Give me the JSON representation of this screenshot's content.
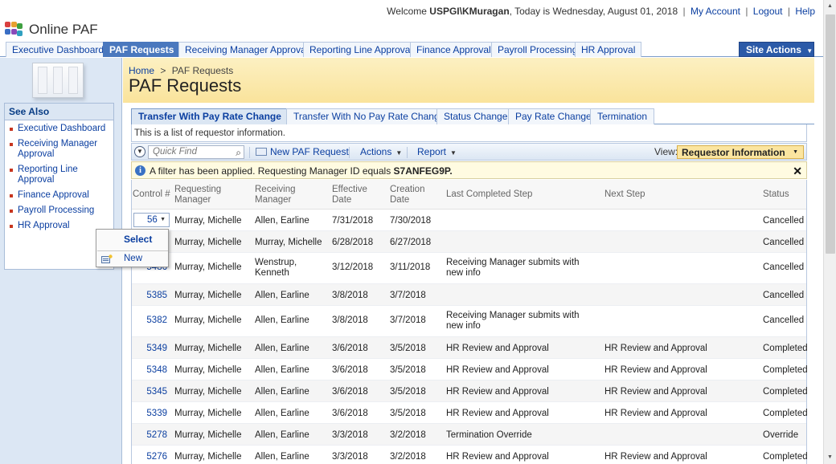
{
  "welcome": {
    "prefix": "Welcome",
    "user": "USPGI\\KMuragan",
    "today": ", Today is Wednesday, August 01, 2018",
    "links": [
      "My Account",
      "Logout",
      "Help"
    ]
  },
  "brand": {
    "title": "Online PAF"
  },
  "nav_tabs": [
    "Executive Dashboard",
    "PAF Requests",
    "Receiving Manager Approval",
    "Reporting Line Approval",
    "Finance Approval",
    "Payroll Processing",
    "HR Approval"
  ],
  "nav_active": "PAF Requests",
  "site_actions": {
    "label": "Site Actions",
    "arrow": "▼"
  },
  "see_also": {
    "title": "See Also",
    "items": [
      "Executive Dashboard",
      "Receiving Manager Approval",
      "Reporting Line Approval",
      "Finance Approval",
      "Payroll Processing",
      "HR Approval"
    ]
  },
  "breadcrumb": {
    "home": "Home",
    "separator": ">",
    "current": "PAF Requests"
  },
  "page_title": "PAF Requests",
  "view_tabs": [
    "Transfer With Pay Rate Change",
    "Transfer With No Pay Rate Change",
    "Status Change",
    "Pay Rate Change",
    "Termination"
  ],
  "list_description": "This is a list of requestor information.",
  "toolbar": {
    "quick_find_placeholder": "Quick Find",
    "new_request": "New PAF Request",
    "actions": "Actions",
    "report": "Report",
    "view_label": "View:",
    "view_value": "Requestor Information"
  },
  "filter": {
    "text": "A filter has been applied. Requesting Manager ID equals ",
    "value": "S7ANFEG9P."
  },
  "columns": [
    "Control #",
    "Requesting Manager",
    "Receiving Manager",
    "Effective Date",
    "Creation Date",
    "Last Completed Step",
    "Next Step",
    "Status"
  ],
  "rows": [
    {
      "control": "56",
      "req": "Murray, Michelle",
      "recv": "Allen, Earline",
      "eff": "7/31/2018",
      "created": "7/30/2018",
      "last": "",
      "next": "",
      "status": "Cancelled"
    },
    {
      "control": "",
      "req": "Murray, Michelle",
      "recv": "Murray, Michelle",
      "eff": "6/28/2018",
      "created": "6/27/2018",
      "last": "",
      "next": "",
      "status": "Cancelled"
    },
    {
      "control": "5486",
      "req": "Murray, Michelle",
      "recv": "Wenstrup, Kenneth",
      "eff": "3/12/2018",
      "created": "3/11/2018",
      "last": "Receiving Manager submits with new info",
      "next": "",
      "status": "Cancelled"
    },
    {
      "control": "5385",
      "req": "Murray, Michelle",
      "recv": "Allen, Earline",
      "eff": "3/8/2018",
      "created": "3/7/2018",
      "last": "",
      "next": "",
      "status": "Cancelled"
    },
    {
      "control": "5382",
      "req": "Murray, Michelle",
      "recv": "Allen, Earline",
      "eff": "3/8/2018",
      "created": "3/7/2018",
      "last": "Receiving Manager submits with new info",
      "next": "",
      "status": "Cancelled"
    },
    {
      "control": "5349",
      "req": "Murray, Michelle",
      "recv": "Allen, Earline",
      "eff": "3/6/2018",
      "created": "3/5/2018",
      "last": "HR Review and Approval",
      "next": "HR Review and Approval",
      "status": "Completed"
    },
    {
      "control": "5348",
      "req": "Murray, Michelle",
      "recv": "Allen, Earline",
      "eff": "3/6/2018",
      "created": "3/5/2018",
      "last": "HR Review and Approval",
      "next": "HR Review and Approval",
      "status": "Completed"
    },
    {
      "control": "5345",
      "req": "Murray, Michelle",
      "recv": "Allen, Earline",
      "eff": "3/6/2018",
      "created": "3/5/2018",
      "last": "HR Review and Approval",
      "next": "HR Review and Approval",
      "status": "Completed"
    },
    {
      "control": "5339",
      "req": "Murray, Michelle",
      "recv": "Allen, Earline",
      "eff": "3/6/2018",
      "created": "3/5/2018",
      "last": "HR Review and Approval",
      "next": "HR Review and Approval",
      "status": "Completed"
    },
    {
      "control": "5278",
      "req": "Murray, Michelle",
      "recv": "Allen, Earline",
      "eff": "3/3/2018",
      "created": "3/2/2018",
      "last": "Termination Override",
      "next": "",
      "status": "Override"
    },
    {
      "control": "5276",
      "req": "Murray, Michelle",
      "recv": "Allen, Earline",
      "eff": "3/3/2018",
      "created": "3/2/2018",
      "last": "HR Review and Approval",
      "next": "HR Review and Approval",
      "status": "Completed"
    }
  ],
  "context_menu": {
    "select": "Select",
    "new": "New"
  },
  "colors": {
    "accent": "#4a78be",
    "header_band": "#fae39b",
    "link": "#0a3ea0",
    "view_select": "#fbe5a0"
  }
}
